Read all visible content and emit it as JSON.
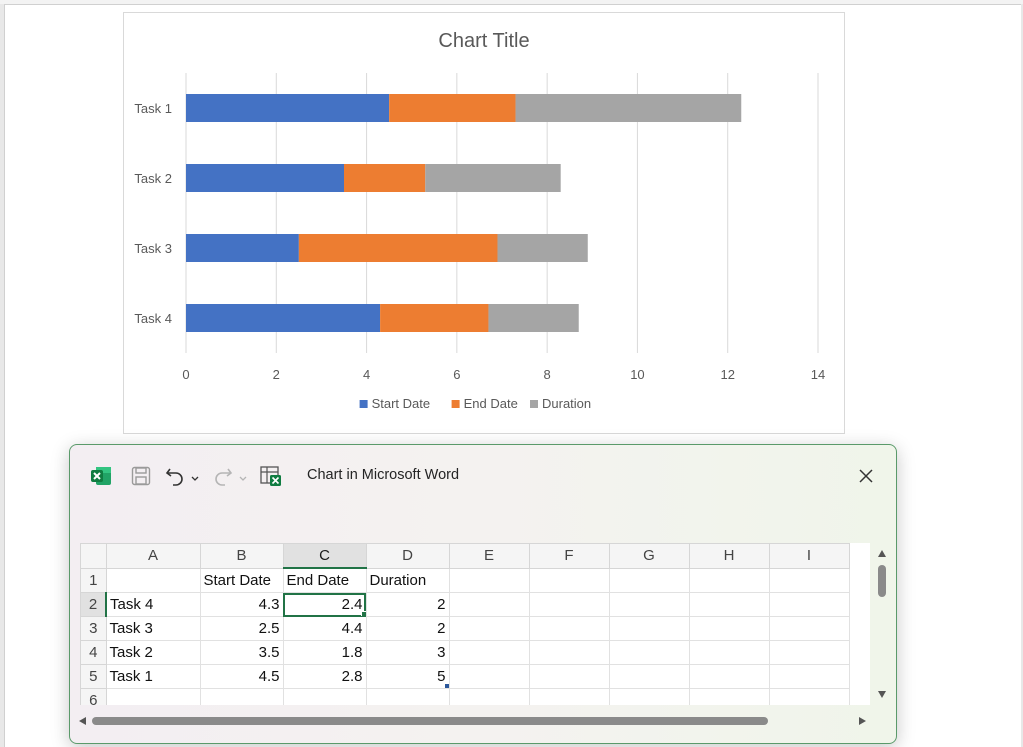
{
  "chart_data": {
    "type": "bar",
    "orientation": "horizontal",
    "stacked": true,
    "title": "Chart Title",
    "categories": [
      "Task 1",
      "Task 2",
      "Task 3",
      "Task 4"
    ],
    "series": [
      {
        "name": "Start Date",
        "color": "#4472c4",
        "values": [
          4.5,
          3.5,
          2.5,
          4.3
        ]
      },
      {
        "name": "End Date",
        "color": "#ed7d31",
        "values": [
          2.8,
          1.8,
          4.4,
          2.4
        ]
      },
      {
        "name": "Duration",
        "color": "#a5a5a5",
        "values": [
          5,
          3,
          2,
          2
        ]
      }
    ],
    "x_ticks": [
      "0",
      "2",
      "4",
      "6",
      "8",
      "10",
      "12",
      "14"
    ],
    "xlim": [
      0,
      14
    ],
    "grid": true,
    "legend_position": "bottom"
  },
  "excel_window": {
    "title": "Chart in Microsoft Word",
    "icons": [
      "excel-icon",
      "save-icon",
      "undo-icon",
      "redo-icon",
      "edit-data-icon",
      "close-icon"
    ]
  },
  "sheet": {
    "columns": [
      "A",
      "B",
      "C",
      "D",
      "E",
      "F",
      "G",
      "H",
      "I"
    ],
    "rows": [
      {
        "num": "1",
        "cells": [
          "",
          "Start Date",
          "End Date",
          "Duration"
        ]
      },
      {
        "num": "2",
        "cells": [
          "Task 4",
          "4.3",
          "2.4",
          "2"
        ]
      },
      {
        "num": "3",
        "cells": [
          "Task 3",
          "2.5",
          "4.4",
          "2"
        ]
      },
      {
        "num": "4",
        "cells": [
          "Task 2",
          "3.5",
          "1.8",
          "3"
        ]
      },
      {
        "num": "5",
        "cells": [
          "Task 1",
          "4.5",
          "2.8",
          "5"
        ]
      },
      {
        "num": "6",
        "cells": [
          "",
          "",
          "",
          ""
        ]
      }
    ],
    "active_cell": "C2"
  }
}
